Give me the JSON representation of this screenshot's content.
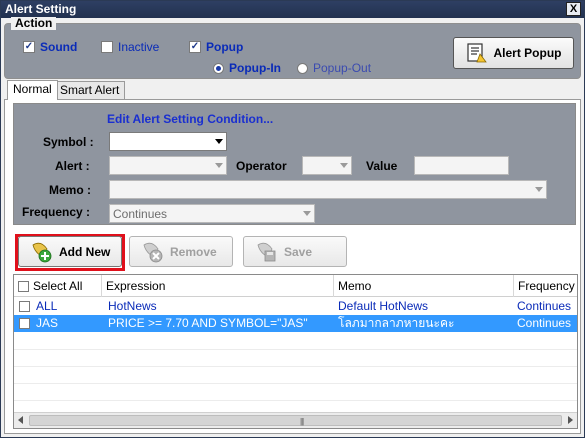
{
  "window": {
    "title": "Alert Setting",
    "close_label": "X"
  },
  "action": {
    "legend": "Action",
    "sound": {
      "label": "Sound",
      "checked": true
    },
    "inactive": {
      "label": "Inactive",
      "checked": false
    },
    "popup": {
      "label": "Popup",
      "checked": true
    },
    "popup_in": {
      "label": "Popup-In",
      "selected": true
    },
    "popup_out": {
      "label": "Popup-Out",
      "selected": false
    },
    "alert_popup_button": "Alert Popup"
  },
  "tabs": [
    {
      "label": "Normal",
      "active": true
    },
    {
      "label": "Smart Alert",
      "active": false
    }
  ],
  "condition": {
    "title": "Edit Alert Setting Condition...",
    "symbol_label": "Symbol :",
    "symbol_value": "",
    "alert_label": "Alert :",
    "alert_value": "",
    "operator_label": "Operator",
    "operator_value": "",
    "value_label": "Value",
    "value_value": "",
    "memo_label": "Memo :",
    "memo_value": "",
    "frequency_label": "Frequency :",
    "frequency_value": "Continues"
  },
  "buttons": {
    "add_new": "Add New",
    "remove": "Remove",
    "save": "Save"
  },
  "grid": {
    "headers": [
      "Select All",
      "Expression",
      "Memo",
      "Frequency"
    ],
    "rows": [
      {
        "symbol": "ALL",
        "expression": "HotNews",
        "memo": "Default HotNews",
        "frequency": "Continues",
        "selected": false
      },
      {
        "symbol": "JAS",
        "expression": "PRICE >= 7.70 AND SYMBOL=\"JAS\"",
        "memo": "โลภมากลาภหายนะคะ",
        "frequency": "Continues",
        "selected": true
      }
    ]
  },
  "colors": {
    "title_bar": "#22314f",
    "panel_gray": "#8f959f",
    "link_blue": "#0a2bb8",
    "selection": "#3399ff",
    "highlight_red": "#e0101b"
  }
}
